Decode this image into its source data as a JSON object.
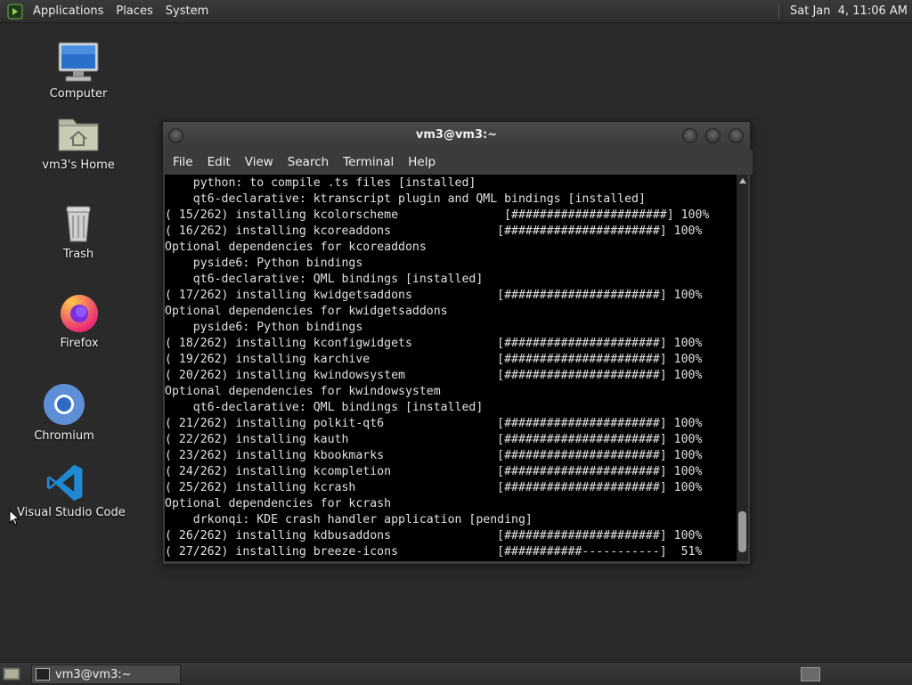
{
  "top_panel": {
    "menus": [
      "Applications",
      "Places",
      "System"
    ],
    "clock": "Sat Jan  4, 11:06 AM"
  },
  "desktop": {
    "icons": [
      {
        "label": "Computer",
        "icon": "computer-icon"
      },
      {
        "label": "vm3's Home",
        "icon": "home-folder-icon"
      },
      {
        "label": "Trash",
        "icon": "trash-icon"
      },
      {
        "label": "Firefox",
        "icon": "firefox-icon"
      },
      {
        "label": "Chromium",
        "icon": "chromium-icon"
      },
      {
        "label": "Visual Studio Code",
        "icon": "vscode-icon"
      }
    ]
  },
  "terminal": {
    "title": "vm3@vm3:~",
    "menu": [
      "File",
      "Edit",
      "View",
      "Search",
      "Terminal",
      "Help"
    ],
    "lines": [
      "    python: to compile .ts files [installed]",
      "    qt6-declarative: ktranscript plugin and QML bindings [installed]",
      "( 15/262) installing kcolorscheme               [######################] 100%",
      "( 16/262) installing kcoreaddons               [######################] 100%",
      "Optional dependencies for kcoreaddons",
      "    pyside6: Python bindings",
      "    qt6-declarative: QML bindings [installed]",
      "( 17/262) installing kwidgetsaddons            [######################] 100%",
      "Optional dependencies for kwidgetsaddons",
      "    pyside6: Python bindings",
      "( 18/262) installing kconfigwidgets            [######################] 100%",
      "( 19/262) installing karchive                  [######################] 100%",
      "( 20/262) installing kwindowsystem             [######################] 100%",
      "Optional dependencies for kwindowsystem",
      "    qt6-declarative: QML bindings [installed]",
      "( 21/262) installing polkit-qt6                [######################] 100%",
      "( 22/262) installing kauth                     [######################] 100%",
      "( 23/262) installing kbookmarks                [######################] 100%",
      "( 24/262) installing kcompletion               [######################] 100%",
      "( 25/262) installing kcrash                    [######################] 100%",
      "Optional dependencies for kcrash",
      "    drkonqi: KDE crash handler application [pending]",
      "( 26/262) installing kdbusaddons               [######################] 100%",
      "( 27/262) installing breeze-icons              [###########-----------]  51%"
    ]
  },
  "bottom_panel": {
    "task_label": "vm3@vm3:~"
  }
}
